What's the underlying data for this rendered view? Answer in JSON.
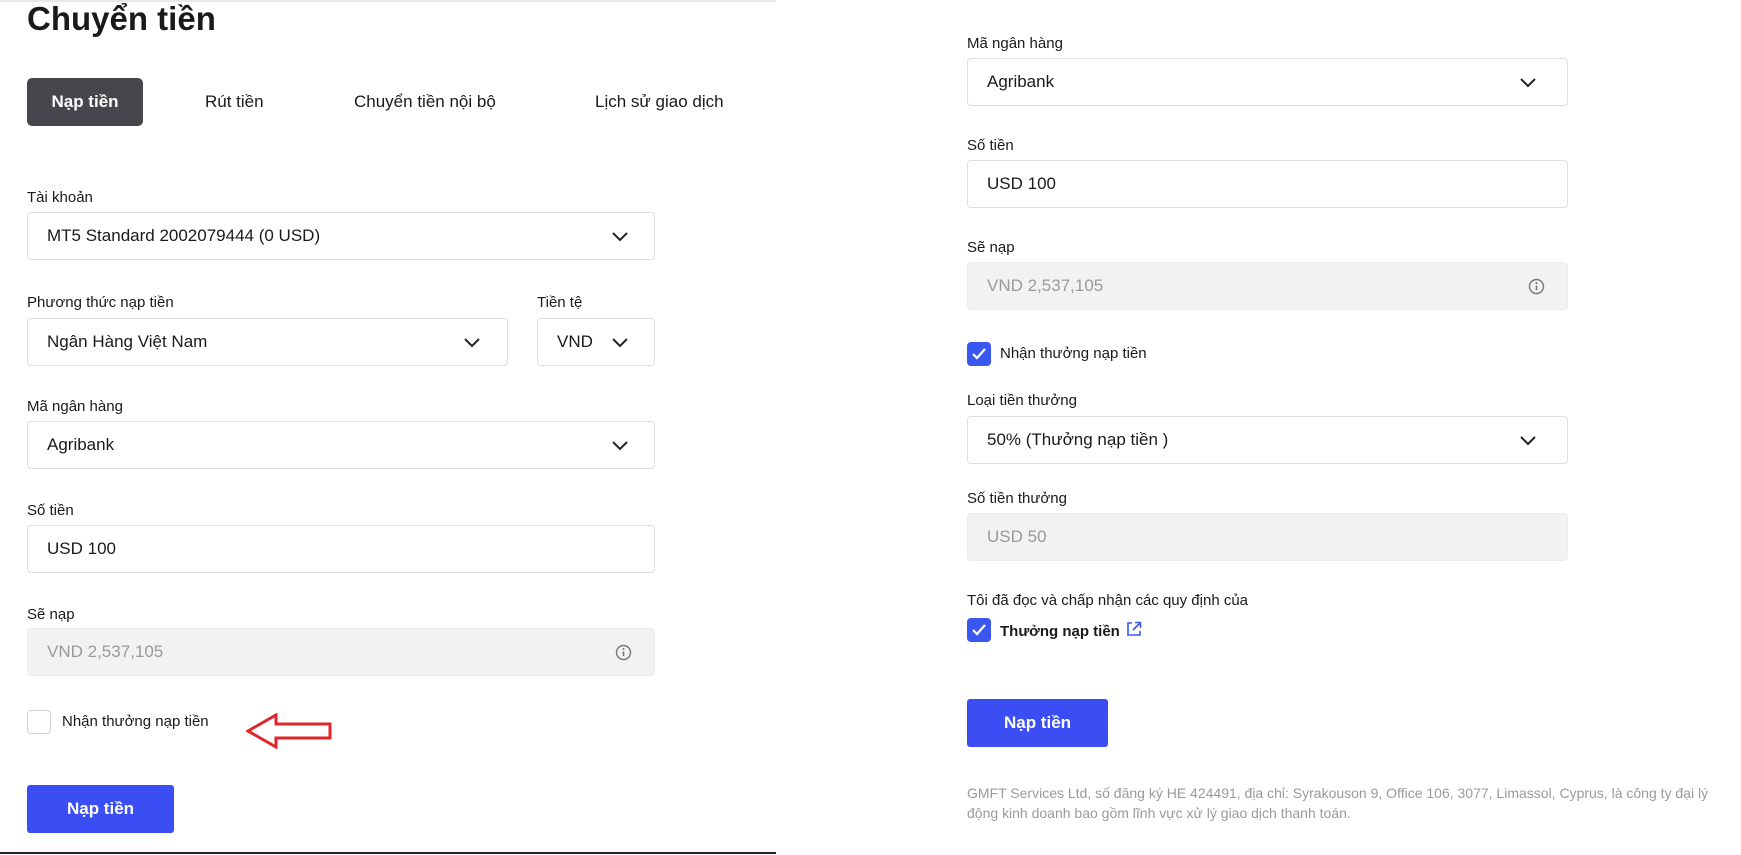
{
  "left": {
    "title": "Chuyển tiền",
    "tabs": [
      {
        "label": "Nạp tiền",
        "active": true
      },
      {
        "label": "Rút tiền",
        "active": false
      },
      {
        "label": "Chuyển tiền nội bộ",
        "active": false
      },
      {
        "label": "Lịch sử giao dịch",
        "active": false
      }
    ],
    "account": {
      "label": "Tài khoản",
      "value": "MT5 Standard 2002079444 (0 USD)"
    },
    "method": {
      "label": "Phương thức nạp tiền",
      "value": "Ngân Hàng Việt Nam"
    },
    "currency": {
      "label": "Tiền tệ",
      "value": "VND"
    },
    "bank": {
      "label": "Mã ngân hàng",
      "value": "Agribank"
    },
    "amount": {
      "label": "Số tiền",
      "value": "USD 100"
    },
    "will_deposit": {
      "label": "Sẽ nạp",
      "value": "VND 2,537,105"
    },
    "bonus_checkbox": {
      "label": "Nhận thưởng nạp tiền",
      "checked": false
    },
    "submit_label": "Nạp tiền"
  },
  "right": {
    "bank": {
      "label": "Mã ngân hàng",
      "value": "Agribank"
    },
    "amount": {
      "label": "Số tiền",
      "value": "USD 100"
    },
    "will_deposit": {
      "label": "Sẽ nạp",
      "value": "VND 2,537,105"
    },
    "bonus_checkbox": {
      "label": "Nhận thưởng nạp tiền",
      "checked": true
    },
    "bonus_type": {
      "label": "Loại tiền thưởng",
      "value": "50% (Thưởng nạp tiền )"
    },
    "bonus_amount": {
      "label": "Số tiền thưởng",
      "value": "USD 50"
    },
    "terms_text": "Tôi đã đọc và chấp nhận các quy định của",
    "terms_checkbox": {
      "label": "Thưởng nạp tiền",
      "checked": true
    },
    "submit_label": "Nạp tiền",
    "footer_line1": "GMFT Services Ltd, số đăng ký HE 424491, địa chỉ: Syrakouson 9, Office 106, 3077, Limassol, Cyprus, là công ty đại lý",
    "footer_line2": "động kinh doanh bao gồm lĩnh vực xử lý giao dịch thanh toán."
  },
  "colors": {
    "accent": "#3a4ef4",
    "active_tab": "#46464c",
    "annotation_arrow": "#e0262b"
  },
  "icons": [
    "chevron-down-icon",
    "info-icon",
    "check-icon",
    "external-link-icon",
    "red-arrow-annotation"
  ]
}
